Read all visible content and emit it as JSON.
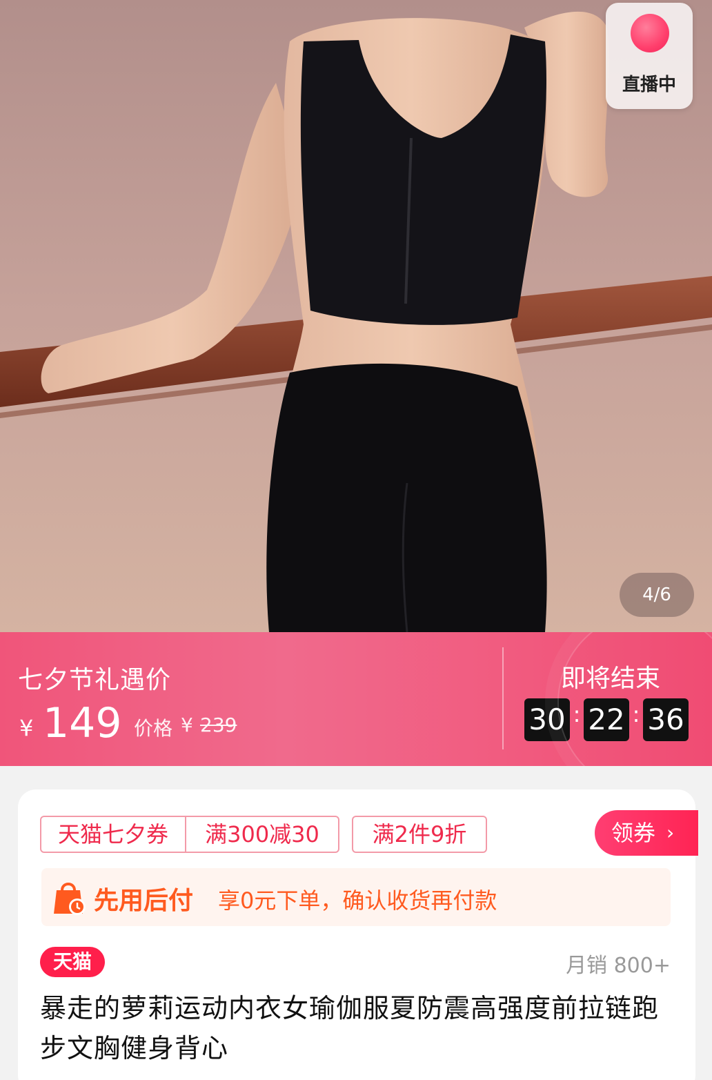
{
  "hero": {
    "image_alt": "",
    "live_label": "直播中",
    "page_indicator": "4/6"
  },
  "promo": {
    "title": "七夕节礼遇价",
    "currency": "¥",
    "price": "149",
    "original_label": "价格",
    "original_currency": "¥",
    "original_price": "239",
    "countdown_label": "即将结束",
    "countdown": [
      "30",
      "22",
      "36"
    ]
  },
  "coupons": {
    "tmall_coupon": "天猫七夕券",
    "coupon_1": "满300减30",
    "coupon_2": "满2件9折",
    "claim_button": "领券",
    "claim_chevron": "›"
  },
  "paylater": {
    "title": "先用后付",
    "desc": "享0元下单，确认收货再付款"
  },
  "product": {
    "store_tag": "天猫",
    "monthly_sales": "月销 800+",
    "title": "暴走的萝莉运动内衣女瑜伽服夏防震高强度前拉链跑步文胸健身背心"
  },
  "colors": {
    "accent": "#ff2454",
    "promo_bg": "#f0557a",
    "paylater": "#ff5a1f"
  }
}
